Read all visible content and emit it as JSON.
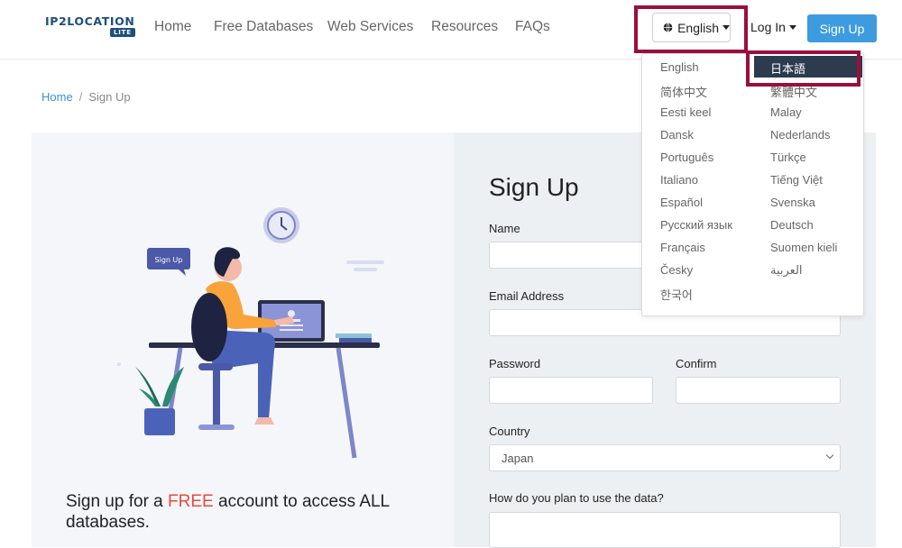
{
  "header": {
    "logo_text": "IP2LOCATION",
    "logo_badge": "LITE",
    "nav": [
      "Home",
      "Free Databases",
      "Web Services",
      "Resources",
      "FAQs"
    ],
    "language_button": "English",
    "login": "Log In",
    "signup": "Sign Up"
  },
  "breadcrumb": {
    "home": "Home",
    "separator": "/",
    "current": "Sign Up"
  },
  "left": {
    "illustration_bubble": "Sign Up",
    "promo_pre": "Sign up for a ",
    "promo_free": "FREE",
    "promo_mid": " account to access ",
    "promo_all": "ALL",
    "promo_post": " databases."
  },
  "form": {
    "title": "Sign Up",
    "name_label": "Name",
    "email_label": "Email Address",
    "password_label": "Password",
    "confirm_label": "Confirm",
    "country_label": "Country",
    "country_value": "Japan",
    "usage_label": "How do you plan to use the data?"
  },
  "language_menu": {
    "selected": "日本語",
    "left_column": [
      "English",
      "简体中文",
      "Eesti keel",
      "Dansk",
      "Português",
      "Italiano",
      "Español",
      "Русский язык",
      "Français",
      "Česky",
      "한국어"
    ],
    "right_column": [
      "繁體中文",
      "Malay",
      "Nederlands",
      "Türkçe",
      "Tiếng Việt",
      "Svenska",
      "Deutsch",
      "Suomen kieli",
      "العربية"
    ]
  },
  "colors": {
    "primary": "#3d9be0",
    "highlight": "#9b0e3e",
    "free_accent": "#e84a3d",
    "menu_active_bg": "#2c3b4e"
  }
}
